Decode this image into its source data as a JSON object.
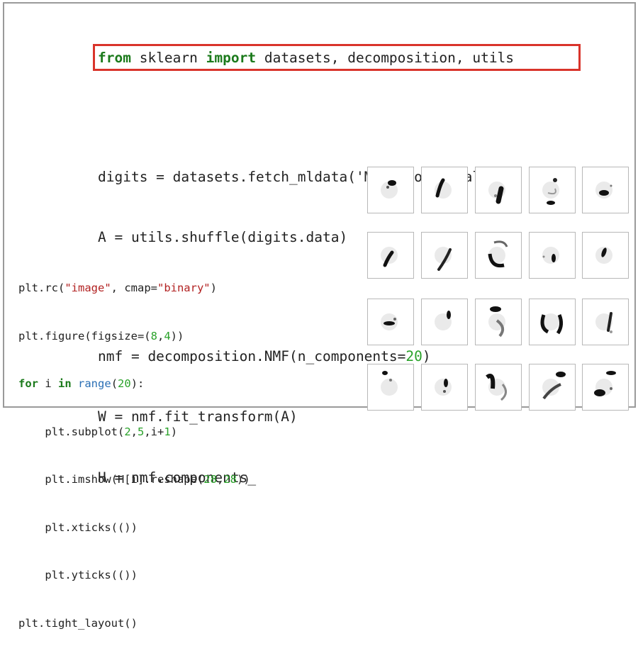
{
  "top_code": {
    "line1": {
      "kw1": "from",
      "mid": " sklearn ",
      "kw2": "import",
      "rest": " datasets, decomposition, utils"
    },
    "line2": {
      "a": "digits = datasets.fetch_mldata(",
      "s": "'MNIST original'",
      "b": ")"
    },
    "line3": "A = utils.shuffle(digits.data)",
    "line4": {
      "a": "nmf = decomposition.NMF(n_components=",
      "n": "20",
      "b": ")"
    },
    "line5": "W = nmf.fit_transform(A)",
    "line6": "H = nmf.components_"
  },
  "bottom_code": {
    "l1": {
      "a": "plt.rc(",
      "s1": "\"image\"",
      "b": ", cmap=",
      "s2": "\"binary\"",
      "c": ")"
    },
    "l2": {
      "a": "plt.figure(figsize=(",
      "n1": "8",
      "b": ",",
      "n2": "4",
      "c": "))"
    },
    "l3": {
      "kw1": "for",
      "a": " i ",
      "kw2": "in",
      "b": " ",
      "fn": "range",
      "c": "(",
      "n": "20",
      "d": "):"
    },
    "l4": {
      "a": "    plt.subplot(",
      "n1": "2",
      "b": ",",
      "n2": "5",
      "c": ",i+",
      "n3": "1",
      "d": ")"
    },
    "l5": {
      "a": "    plt.imshow(H[i].reshape(",
      "n1": "28",
      "b": ",",
      "n2": "28",
      "c": "))"
    },
    "l6": "    plt.xticks(())",
    "l7": "    plt.yticks(())",
    "l8": "plt.tight_layout()"
  },
  "highlight_color": "#d9342b",
  "component_images_count": 20
}
